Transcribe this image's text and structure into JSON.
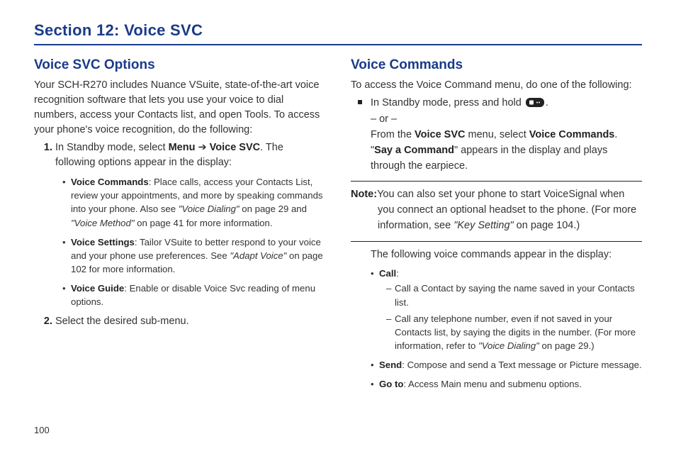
{
  "pageNumber": "100",
  "sectionTitle": "Section 12: Voice SVC",
  "left": {
    "heading": "Voice SVC Options",
    "intro": "Your SCH-R270 includes Nuance VSuite, state-of-the-art voice recognition software that lets you use your voice to dial numbers, access your Contacts list, and open Tools. To access your phone's voice recognition, do the following:",
    "step1_a": "In Standby mode, select ",
    "step1_menu": "Menu",
    "step1_arrow": " ➔ ",
    "step1_voicesvc": "Voice SVC",
    "step1_b": ". The following options appear in the display:",
    "bullet1_b": "Voice Commands",
    "bullet1_t1": ": Place calls, access your Contacts List, review your appointments, and more by speaking commands into your phone. Also see ",
    "bullet1_ref1": "\"Voice Dialing\"",
    "bullet1_t2": " on page 29 and ",
    "bullet1_ref2": "\"Voice Method\"",
    "bullet1_t3": " on page 41 for more information.",
    "bullet2_b": "Voice Settings",
    "bullet2_t1": ": Tailor VSuite to better respond to your voice and your phone use preferences. See ",
    "bullet2_ref": "\"Adapt Voice\"",
    "bullet2_t2": " on page 102 for more information.",
    "bullet3_b": "Voice Guide",
    "bullet3_t": ": Enable or disable Voice Svc reading of menu options.",
    "step2": "Select the desired sub-menu."
  },
  "right": {
    "heading": "Voice Commands",
    "intro": "To access the Voice Command menu, do one of the following:",
    "sq1_a": "In Standby mode, press and hold ",
    "sq1_b": ".",
    "or": "– or –",
    "sq2_a": "From the ",
    "sq2_b1": "Voice SVC",
    "sq2_b": " menu, select ",
    "sq2_b2": "Voice Commands",
    "sq2_c": ".",
    "say_a": "\"",
    "say_b": "Say a Command",
    "say_c": "\" appears in the display and plays through the earpiece.",
    "note_b": "Note:",
    "note_t1": "You can also set your phone to start VoiceSignal when you connect an optional headset to the phone. (For more information, see ",
    "note_ref": "\"Key Setting\"",
    "note_t2": " on page 104.)",
    "following": "The following voice commands appear in the display:",
    "call_b": "Call",
    "call_colon": ":",
    "call_d1": "Call a Contact by saying the name saved in your Contacts list.",
    "call_d2a": "Call any telephone number, even if not saved in your Contacts list, by saying the digits in the number. (For more information, refer to ",
    "call_d2ref": "\"Voice Dialing\"",
    "call_d2b": " on page 29.)",
    "send_b": "Send",
    "send_t": ": Compose and send a Text message or Picture message.",
    "goto_b": "Go to",
    "goto_t": ": Access Main menu and submenu options."
  },
  "icons": {
    "okKey": "ok-key-icon"
  }
}
